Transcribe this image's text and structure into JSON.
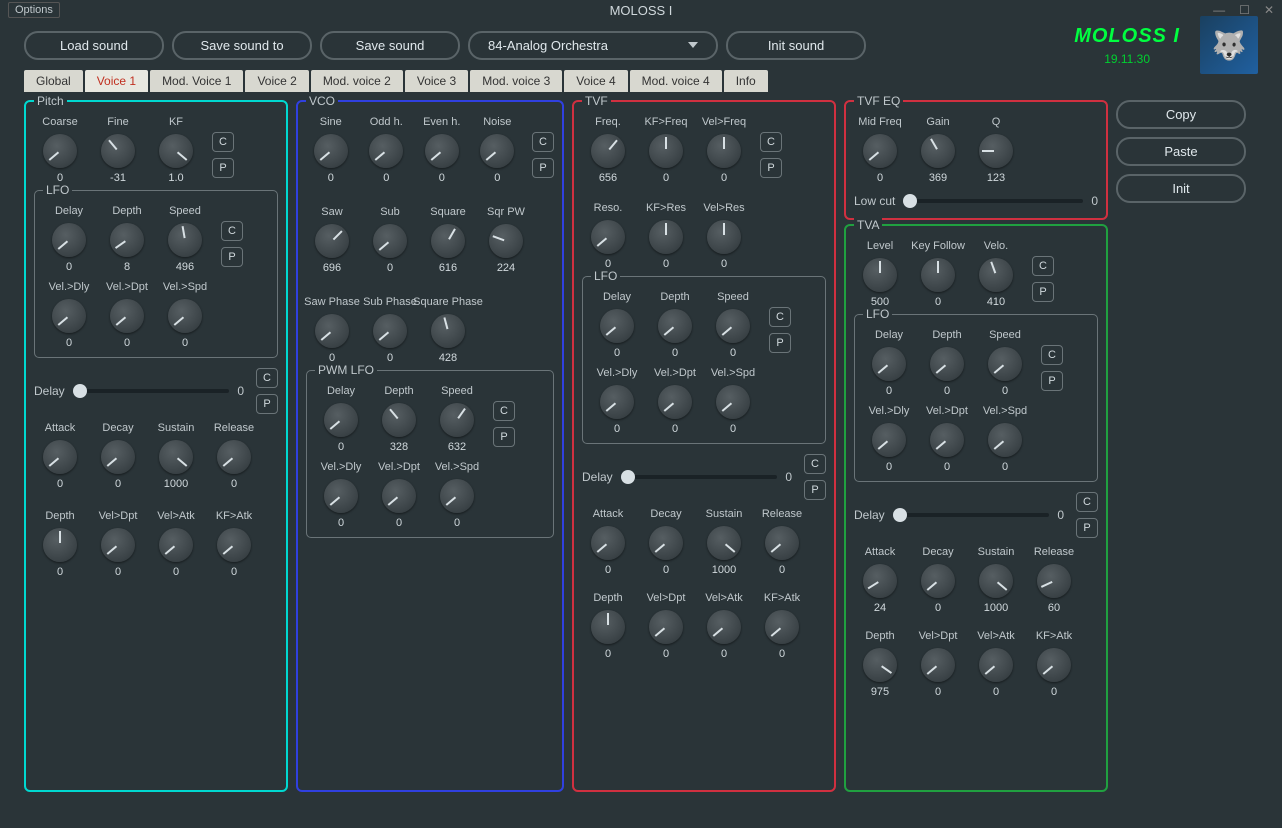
{
  "window_title": "MOLOSS I",
  "options_label": "Options",
  "toolbar": {
    "load": "Load sound",
    "save_to": "Save sound to",
    "save": "Save sound",
    "preset": "84-Analog Orchestra",
    "init": "Init sound"
  },
  "brand": {
    "title": "MOLOSS I",
    "date": "19.11.30"
  },
  "tabs": [
    "Global",
    "Voice 1",
    "Mod. Voice 1",
    "Voice 2",
    "Mod. voice 2",
    "Voice 3",
    "Mod. voice 3",
    "Voice 4",
    "Mod. voice 4",
    "Info"
  ],
  "active_tab": 1,
  "side": {
    "copy": "Copy",
    "paste": "Paste",
    "init": "Init"
  },
  "cp": {
    "c": "C",
    "p": "P"
  },
  "pitch": {
    "title": "Pitch",
    "row1": [
      {
        "label": "Coarse",
        "val": "0",
        "rot": -130
      },
      {
        "label": "Fine",
        "val": "-31",
        "rot": -40
      },
      {
        "label": "KF",
        "val": "1.0",
        "rot": 130
      }
    ],
    "lfo_title": "LFO",
    "lfo1": [
      {
        "label": "Delay",
        "val": "0",
        "rot": -130
      },
      {
        "label": "Depth",
        "val": "8",
        "rot": -125
      },
      {
        "label": "Speed",
        "val": "496",
        "rot": -10
      }
    ],
    "lfo2": [
      {
        "label": "Vel.>Dly",
        "val": "0",
        "rot": -130
      },
      {
        "label": "Vel.>Dpt",
        "val": "0",
        "rot": -130
      },
      {
        "label": "Vel.>Spd",
        "val": "0",
        "rot": -130
      }
    ],
    "delay_label": "Delay",
    "delay_val": "0",
    "adsr": [
      {
        "label": "Attack",
        "val": "0",
        "rot": -130
      },
      {
        "label": "Decay",
        "val": "0",
        "rot": -130
      },
      {
        "label": "Sustain",
        "val": "1000",
        "rot": 130
      },
      {
        "label": "Release",
        "val": "0",
        "rot": -130
      }
    ],
    "mod": [
      {
        "label": "Depth",
        "val": "0",
        "rot": 0
      },
      {
        "label": "Vel>Dpt",
        "val": "0",
        "rot": -130
      },
      {
        "label": "Vel>Atk",
        "val": "0",
        "rot": -130
      },
      {
        "label": "KF>Atk",
        "val": "0",
        "rot": -130
      }
    ]
  },
  "vco": {
    "title": "VCO",
    "row1": [
      {
        "label": "Sine",
        "val": "0",
        "rot": -130
      },
      {
        "label": "Odd h.",
        "val": "0",
        "rot": -130
      },
      {
        "label": "Even h.",
        "val": "0",
        "rot": -130
      },
      {
        "label": "Noise",
        "val": "0",
        "rot": -130
      }
    ],
    "row2": [
      {
        "label": "Saw",
        "val": "696",
        "rot": 45
      },
      {
        "label": "Sub",
        "val": "0",
        "rot": -130
      },
      {
        "label": "Square",
        "val": "616",
        "rot": 30
      },
      {
        "label": "Sqr PW",
        "val": "224",
        "rot": -70
      }
    ],
    "row3": [
      {
        "label": "Saw Phase",
        "val": "0",
        "rot": -130
      },
      {
        "label": "Sub Phase",
        "val": "0",
        "rot": -130
      },
      {
        "label": "Square Phase",
        "val": "428",
        "rot": -15
      }
    ],
    "pwm_title": "PWM LFO",
    "pwm1": [
      {
        "label": "Delay",
        "val": "0",
        "rot": -130
      },
      {
        "label": "Depth",
        "val": "328",
        "rot": -40
      },
      {
        "label": "Speed",
        "val": "632",
        "rot": 35
      }
    ],
    "pwm2": [
      {
        "label": "Vel.>Dly",
        "val": "0",
        "rot": -130
      },
      {
        "label": "Vel.>Dpt",
        "val": "0",
        "rot": -130
      },
      {
        "label": "Vel.>Spd",
        "val": "0",
        "rot": -130
      }
    ]
  },
  "tvf": {
    "title": "TVF",
    "row1": [
      {
        "label": "Freq.",
        "val": "656",
        "rot": 40
      },
      {
        "label": "KF>Freq",
        "val": "0",
        "rot": 0
      },
      {
        "label": "Vel>Freq",
        "val": "0",
        "rot": 0
      }
    ],
    "row2": [
      {
        "label": "Reso.",
        "val": "0",
        "rot": -130
      },
      {
        "label": "KF>Res",
        "val": "0",
        "rot": 0
      },
      {
        "label": "Vel>Res",
        "val": "0",
        "rot": 0
      }
    ],
    "lfo_title": "LFO",
    "lfo1": [
      {
        "label": "Delay",
        "val": "0",
        "rot": -130
      },
      {
        "label": "Depth",
        "val": "0",
        "rot": -130
      },
      {
        "label": "Speed",
        "val": "0",
        "rot": -130
      }
    ],
    "lfo2": [
      {
        "label": "Vel.>Dly",
        "val": "0",
        "rot": -130
      },
      {
        "label": "Vel.>Dpt",
        "val": "0",
        "rot": -130
      },
      {
        "label": "Vel.>Spd",
        "val": "0",
        "rot": -130
      }
    ],
    "delay_label": "Delay",
    "delay_val": "0",
    "adsr": [
      {
        "label": "Attack",
        "val": "0",
        "rot": -130
      },
      {
        "label": "Decay",
        "val": "0",
        "rot": -130
      },
      {
        "label": "Sustain",
        "val": "1000",
        "rot": 130
      },
      {
        "label": "Release",
        "val": "0",
        "rot": -130
      }
    ],
    "mod": [
      {
        "label": "Depth",
        "val": "0",
        "rot": 0
      },
      {
        "label": "Vel>Dpt",
        "val": "0",
        "rot": -130
      },
      {
        "label": "Vel>Atk",
        "val": "0",
        "rot": -130
      },
      {
        "label": "KF>Atk",
        "val": "0",
        "rot": -130
      }
    ]
  },
  "tvfeq": {
    "title": "TVF EQ",
    "row": [
      {
        "label": "Mid Freq",
        "val": "0",
        "rot": -130
      },
      {
        "label": "Gain",
        "val": "369",
        "rot": -30
      },
      {
        "label": "Q",
        "val": "123",
        "rot": -90
      }
    ],
    "lowcut_label": "Low cut",
    "lowcut_val": "0"
  },
  "tva": {
    "title": "TVA",
    "row1": [
      {
        "label": "Level",
        "val": "500",
        "rot": 0
      },
      {
        "label": "Key Follow",
        "val": "0",
        "rot": 0
      },
      {
        "label": "Velo.",
        "val": "410",
        "rot": -20
      }
    ],
    "lfo_title": "LFO",
    "lfo1": [
      {
        "label": "Delay",
        "val": "0",
        "rot": -130
      },
      {
        "label": "Depth",
        "val": "0",
        "rot": -130
      },
      {
        "label": "Speed",
        "val": "0",
        "rot": -130
      }
    ],
    "lfo2": [
      {
        "label": "Vel.>Dly",
        "val": "0",
        "rot": -130
      },
      {
        "label": "Vel.>Dpt",
        "val": "0",
        "rot": -130
      },
      {
        "label": "Vel.>Spd",
        "val": "0",
        "rot": -130
      }
    ],
    "delay_label": "Delay",
    "delay_val": "0",
    "adsr": [
      {
        "label": "Attack",
        "val": "24",
        "rot": -122
      },
      {
        "label": "Decay",
        "val": "0",
        "rot": -130
      },
      {
        "label": "Sustain",
        "val": "1000",
        "rot": 130
      },
      {
        "label": "Release",
        "val": "60",
        "rot": -115
      }
    ],
    "mod": [
      {
        "label": "Depth",
        "val": "975",
        "rot": 125
      },
      {
        "label": "Vel>Dpt",
        "val": "0",
        "rot": -130
      },
      {
        "label": "Vel>Atk",
        "val": "0",
        "rot": -130
      },
      {
        "label": "KF>Atk",
        "val": "0",
        "rot": -130
      }
    ]
  }
}
